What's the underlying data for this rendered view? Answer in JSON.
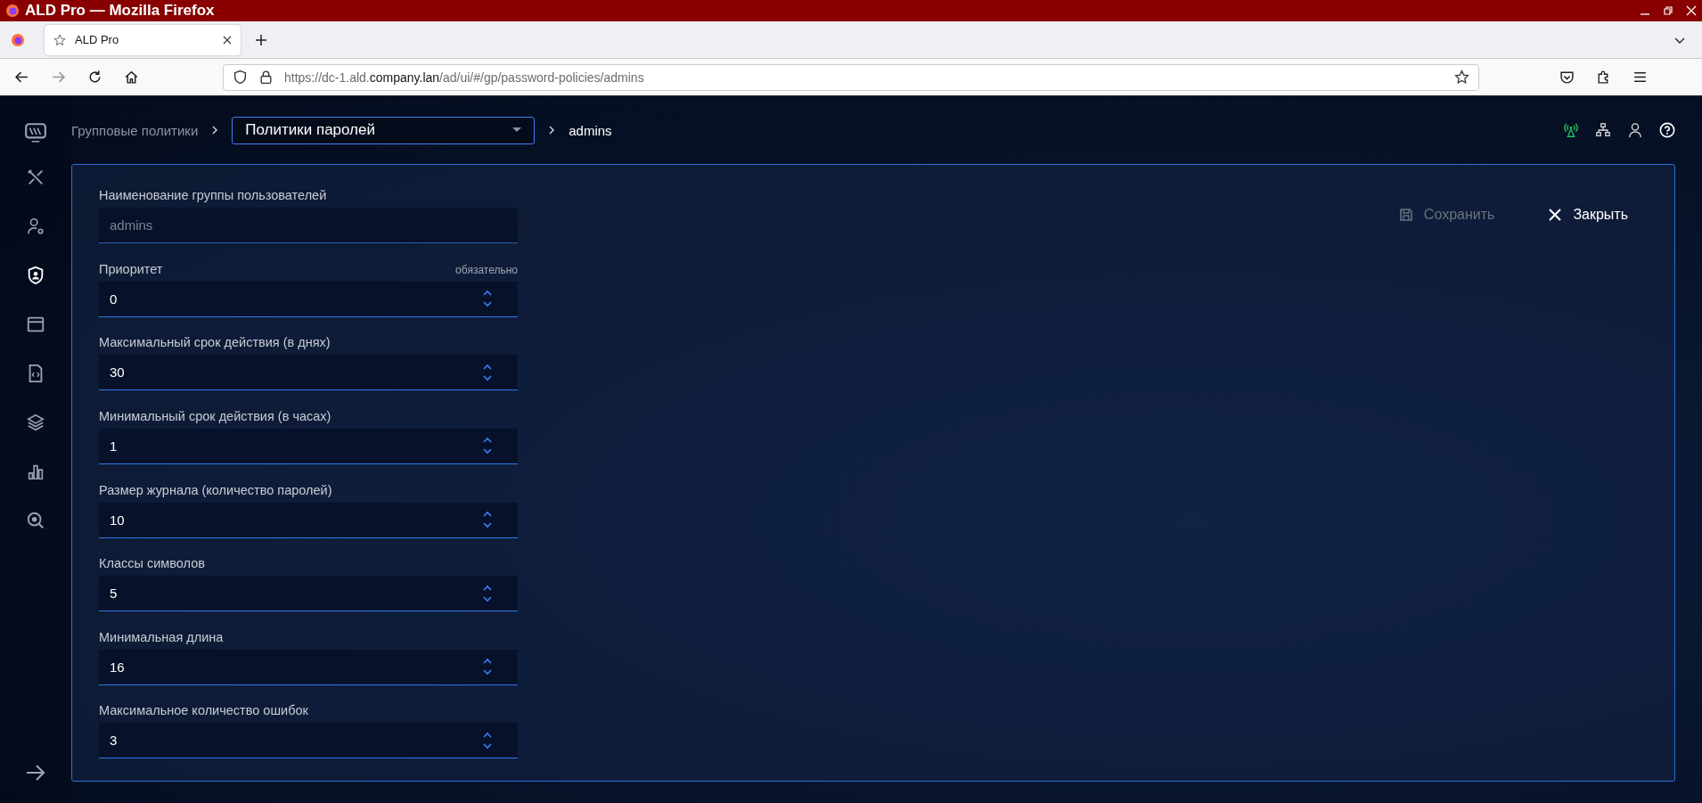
{
  "window": {
    "title": "ALD Pro — Mozilla Firefox"
  },
  "browser": {
    "tab": {
      "title": "ALD Pro",
      "selected": true
    },
    "url": {
      "before": "https://dc-1.ald.",
      "domain": "company.lan",
      "after": "/ad/ui/#/gp/password-policies/admins"
    }
  },
  "sidebar": {
    "items": [
      {
        "kind": "monitor",
        "selected": false
      },
      {
        "kind": "tools",
        "selected": false
      },
      {
        "kind": "usergear",
        "selected": false
      },
      {
        "kind": "shield",
        "selected": true
      },
      {
        "kind": "window",
        "selected": false
      },
      {
        "kind": "codefile",
        "selected": false
      },
      {
        "kind": "layers",
        "selected": false
      },
      {
        "kind": "chart",
        "selected": false
      },
      {
        "kind": "inspect",
        "selected": false
      }
    ]
  },
  "breadcrumb": {
    "parent": "Групповые политики",
    "select": "Политики паролей",
    "current": "admins"
  },
  "actions": {
    "save": {
      "label": "Сохранить",
      "disabled": true
    },
    "close": {
      "label": "Закрыть"
    }
  },
  "fields": [
    {
      "label": "Наименование группы пользователей",
      "value": "admins",
      "kind": "text",
      "disabled": true
    },
    {
      "label": "Приоритет",
      "value": "0",
      "kind": "number",
      "disabled": false,
      "hint": "обязательно"
    },
    {
      "label": "Максимальный срок действия (в днях)",
      "value": "30",
      "kind": "number",
      "disabled": false
    },
    {
      "label": "Минимальный срок действия (в часах)",
      "value": "1",
      "kind": "number",
      "disabled": false
    },
    {
      "label": "Размер журнала (количество паролей)",
      "value": "10",
      "kind": "number",
      "disabled": false
    },
    {
      "label": "Классы символов",
      "value": "5",
      "kind": "number",
      "disabled": false
    },
    {
      "label": "Минимальная длина",
      "value": "16",
      "kind": "number",
      "disabled": false
    },
    {
      "label": "Максимальное количество ошибок",
      "value": "3",
      "kind": "number",
      "disabled": false
    }
  ]
}
